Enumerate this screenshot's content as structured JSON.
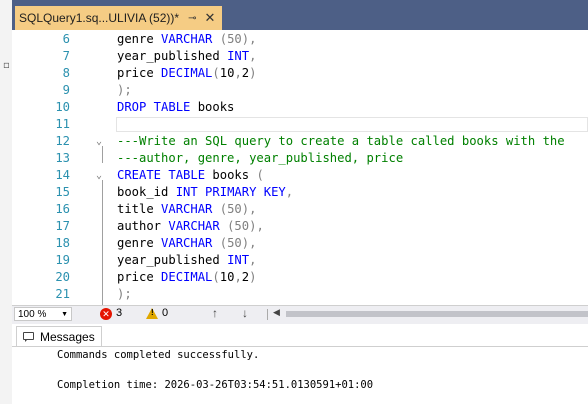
{
  "tab": {
    "title": "SQLQuery1.sq...ULIVIA (52))*",
    "pin_icon": "pin-icon",
    "close_icon": "close-icon"
  },
  "editor": {
    "lines": [
      {
        "num": "6",
        "tokens": [
          [
            "",
            "genre "
          ],
          [
            "kw",
            "VARCHAR"
          ],
          [
            "",
            " "
          ],
          [
            "gr",
            "(50),"
          ]
        ]
      },
      {
        "num": "7",
        "tokens": [
          [
            "",
            "year_published "
          ],
          [
            "kw",
            "INT"
          ],
          [
            "gr",
            ","
          ]
        ]
      },
      {
        "num": "8",
        "tokens": [
          [
            "",
            "price "
          ],
          [
            "kw",
            "DECIMAL"
          ],
          [
            "gr",
            "("
          ],
          [
            "",
            "10"
          ],
          [
            "gr",
            ","
          ],
          [
            "",
            "2"
          ],
          [
            "gr",
            ")"
          ]
        ]
      },
      {
        "num": "9",
        "tokens": [
          [
            "gr",
            ");"
          ]
        ]
      },
      {
        "num": "10",
        "tokens": [
          [
            "kw",
            "DROP TABLE"
          ],
          [
            "",
            " books"
          ]
        ]
      },
      {
        "num": "11",
        "tokens": []
      },
      {
        "num": "12",
        "fold": "⌄",
        "tokens": [
          [
            "cm",
            "---Write an SQL query to create a table called books with the"
          ]
        ]
      },
      {
        "num": "13",
        "tokens": [
          [
            "cm",
            "---author, genre, year_published, price"
          ]
        ]
      },
      {
        "num": "14",
        "fold": "⌄",
        "tokens": [
          [
            "kw",
            "CREATE TABLE"
          ],
          [
            "",
            " books "
          ],
          [
            "gr",
            "("
          ]
        ]
      },
      {
        "num": "15",
        "tokens": [
          [
            "",
            "book_id "
          ],
          [
            "kw",
            "INT PRIMARY KEY"
          ],
          [
            "gr",
            ","
          ]
        ]
      },
      {
        "num": "16",
        "tokens": [
          [
            "",
            "title "
          ],
          [
            "kw",
            "VARCHAR"
          ],
          [
            "",
            " "
          ],
          [
            "gr",
            "(50),"
          ]
        ]
      },
      {
        "num": "17",
        "tokens": [
          [
            "",
            "author "
          ],
          [
            "kw",
            "VARCHAR"
          ],
          [
            "",
            " "
          ],
          [
            "gr",
            "(50),"
          ]
        ]
      },
      {
        "num": "18",
        "tokens": [
          [
            "",
            "genre "
          ],
          [
            "kw",
            "VARCHAR"
          ],
          [
            "",
            " "
          ],
          [
            "gr",
            "(50),"
          ]
        ]
      },
      {
        "num": "19",
        "tokens": [
          [
            "",
            "year_published "
          ],
          [
            "kw",
            "INT"
          ],
          [
            "gr",
            ","
          ]
        ]
      },
      {
        "num": "20",
        "tokens": [
          [
            "",
            "price "
          ],
          [
            "kw",
            "DECIMAL"
          ],
          [
            "gr",
            "("
          ],
          [
            "",
            "10"
          ],
          [
            "gr",
            ","
          ],
          [
            "",
            "2"
          ],
          [
            "gr",
            ")"
          ]
        ]
      },
      {
        "num": "21",
        "tokens": [
          [
            "gr",
            ");"
          ]
        ]
      }
    ],
    "current_line": "11"
  },
  "statusbar": {
    "zoom": "100 %",
    "errors": "3",
    "warnings": "0"
  },
  "results": {
    "tab_label": "Messages",
    "messages": [
      "Commands completed successfully.",
      "",
      "Completion time: 2026-03-26T03:54:51.0130591+01:00"
    ]
  },
  "colors": {
    "keyword": "#0000ff",
    "comment": "#008000",
    "punctuation": "#808080",
    "line_number": "#2b91af",
    "active_tab": "#f5cc84",
    "chrome": "#4d5f86"
  }
}
